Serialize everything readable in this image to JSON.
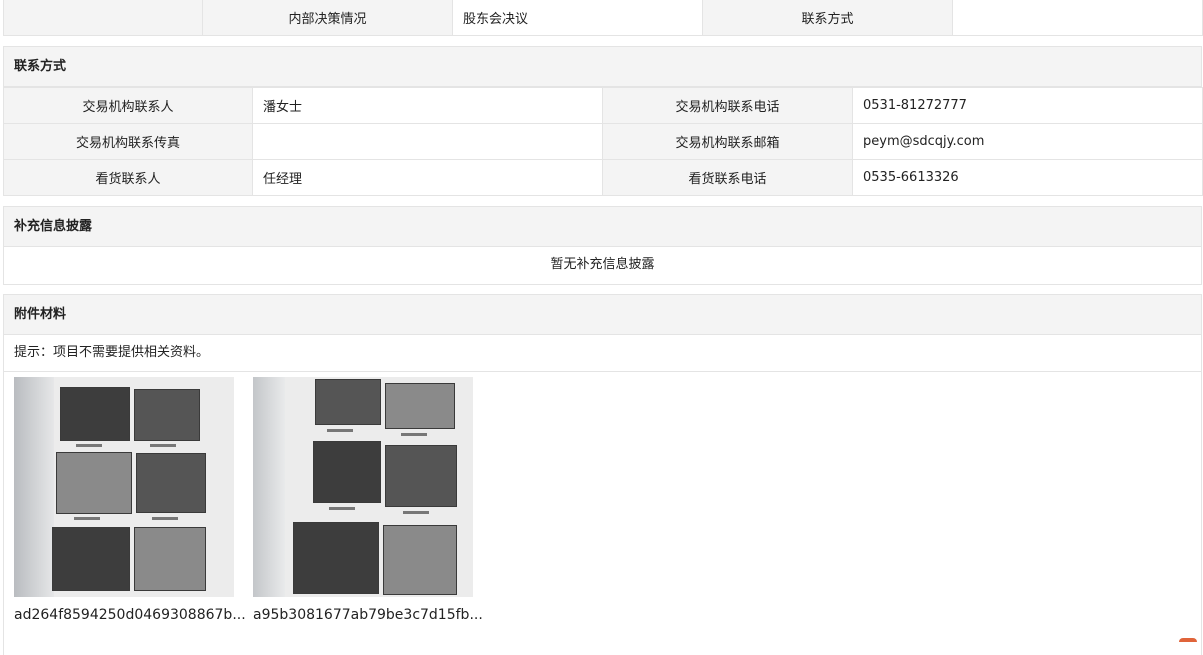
{
  "top_row": {
    "label1": "内部决策情况",
    "value1": "股东会决议",
    "label2": "联系方式",
    "value2": ""
  },
  "contact": {
    "title": "联系方式",
    "rows": [
      {
        "l1": "交易机构联系人",
        "v1": "潘女士",
        "l2": "交易机构联系电话",
        "v2": "0531-81272777"
      },
      {
        "l1": "交易机构联系传真",
        "v1": "",
        "l2": "交易机构联系邮箱",
        "v2": "peym@sdcqjy.com"
      },
      {
        "l1": "看货联系人",
        "v1": "任经理",
        "l2": "看货联系电话",
        "v2": "0535-6613326"
      }
    ]
  },
  "supplement": {
    "title": "补充信息披露",
    "empty_text": "暂无补充信息披露"
  },
  "attachments": {
    "title": "附件材料",
    "hint": "提示：项目不需要提供相关资料。",
    "files": [
      {
        "name": "ad264f8594250d0469308867b..."
      },
      {
        "name": "a95b3081677ab79be3c7d15fb..."
      }
    ]
  }
}
